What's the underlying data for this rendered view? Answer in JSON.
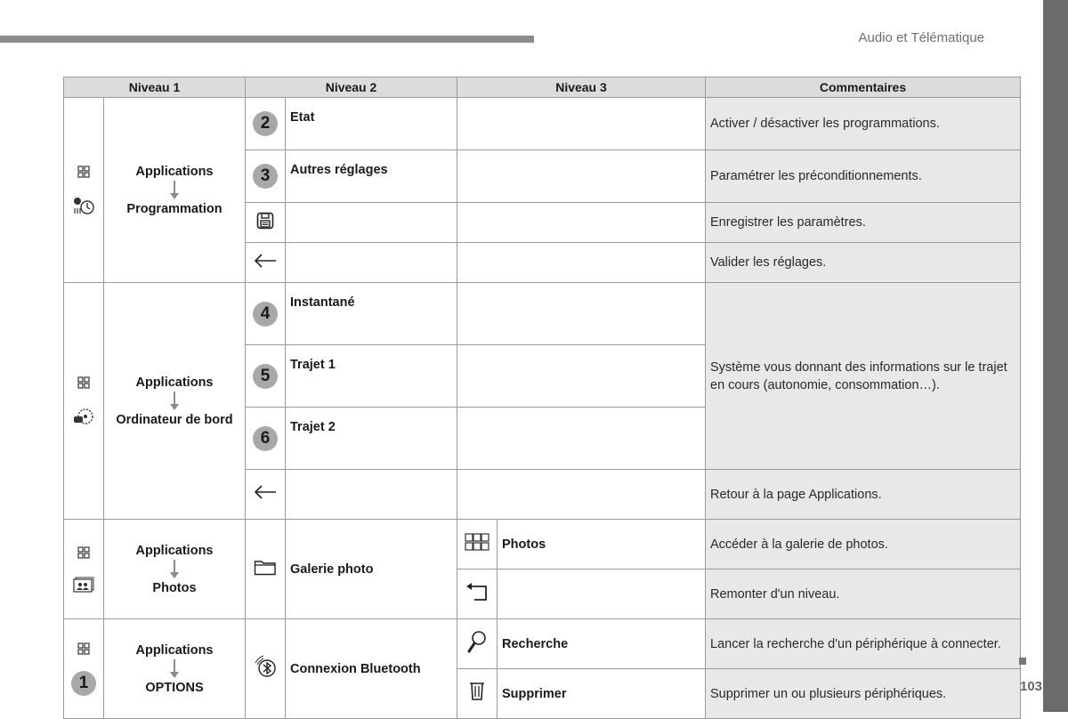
{
  "header": {
    "section_title": "Audio et Télématique"
  },
  "footer": {
    "page_number": "103"
  },
  "table": {
    "columns": [
      "Niveau 1",
      "Niveau 2",
      "Niveau 3",
      "Commentaires"
    ],
    "groups": [
      {
        "level1_from": "Applications",
        "level1_to": "Programmation",
        "icons": [
          "applications-grid-icon",
          "programming-timer-icon"
        ],
        "rows": [
          {
            "level2_icon": "badge-2",
            "badge": "2",
            "level2": "Etat",
            "level3": "",
            "comment": "Activer / désactiver les programmations."
          },
          {
            "level2_icon": "badge-3",
            "badge": "3",
            "level2": "Autres réglages",
            "level3": "",
            "comment": "Paramétrer les préconditionnements."
          },
          {
            "level2_icon": "save-icon",
            "level2": "",
            "level3": "",
            "comment": "Enregistrer les paramètres."
          },
          {
            "level2_icon": "back-arrow-icon",
            "level2": "",
            "level3": "",
            "comment": "Valider les réglages."
          }
        ]
      },
      {
        "level1_from": "Applications",
        "level1_to": "Ordinateur de bord",
        "icons": [
          "applications-grid-icon",
          "trip-computer-icon"
        ],
        "rows": [
          {
            "level2_icon": "badge-4",
            "badge": "4",
            "level2": "Instantané",
            "level3": ""
          },
          {
            "level2_icon": "badge-5",
            "badge": "5",
            "level2": "Trajet 1",
            "level3": ""
          },
          {
            "level2_icon": "badge-6",
            "badge": "6",
            "level2": "Trajet 2",
            "level3": ""
          },
          {
            "level2_icon": "back-arrow-icon",
            "level2": "",
            "level3": "",
            "comment": "Retour à la page Applications."
          }
        ],
        "shared_comment": "Système vous donnant des informations sur le trajet en cours (autonomie, consommation…)."
      },
      {
        "level1_from": "Applications",
        "level1_to": "Photos",
        "icons": [
          "applications-grid-icon",
          "photos-icon"
        ],
        "level2_icon": "folder-icon",
        "level2": "Galerie photo",
        "rows": [
          {
            "level3_icon": "thumbnails-grid-icon",
            "level3": "Photos",
            "comment": "Accéder à la galerie de photos."
          },
          {
            "level3_icon": "return-up-icon",
            "level3": "",
            "comment": "Remonter d'un niveau."
          }
        ]
      },
      {
        "level1_from": "Applications",
        "level1_to": "OPTIONS",
        "icons": [
          "applications-grid-icon",
          "badge-1"
        ],
        "badge": "1",
        "level2_icon": "bluetooth-icon",
        "level2": "Connexion Bluetooth",
        "rows": [
          {
            "level3_icon": "search-icon",
            "level3": "Recherche",
            "comment": "Lancer la recherche d'un périphérique à connecter."
          },
          {
            "level3_icon": "trash-icon",
            "level3": "Supprimer",
            "comment": "Supprimer un ou plusieurs périphériques."
          }
        ]
      }
    ]
  }
}
